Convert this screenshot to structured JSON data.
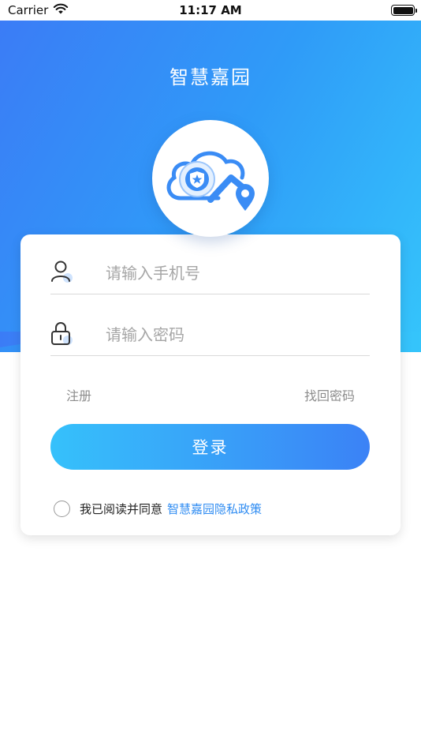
{
  "status_bar": {
    "carrier": "Carrier",
    "time": "11:17 AM"
  },
  "header": {
    "title": "智慧嘉园"
  },
  "logo": {
    "icon": "cloud-shield-house-location-icon"
  },
  "form": {
    "phone_placeholder": "请输入手机号",
    "password_placeholder": "请输入密码",
    "register_label": "注册",
    "forgot_password_label": "找回密码",
    "login_label": "登录"
  },
  "agreement": {
    "text": "我已阅读并同意",
    "link": "智慧嘉园隐私政策",
    "checked": false
  },
  "colors": {
    "gradient_start": "#3b7cf6",
    "gradient_end": "#35c5fb",
    "link": "#2f8cf2",
    "button_start": "#36c1fb",
    "button_end": "#3b82f6"
  }
}
